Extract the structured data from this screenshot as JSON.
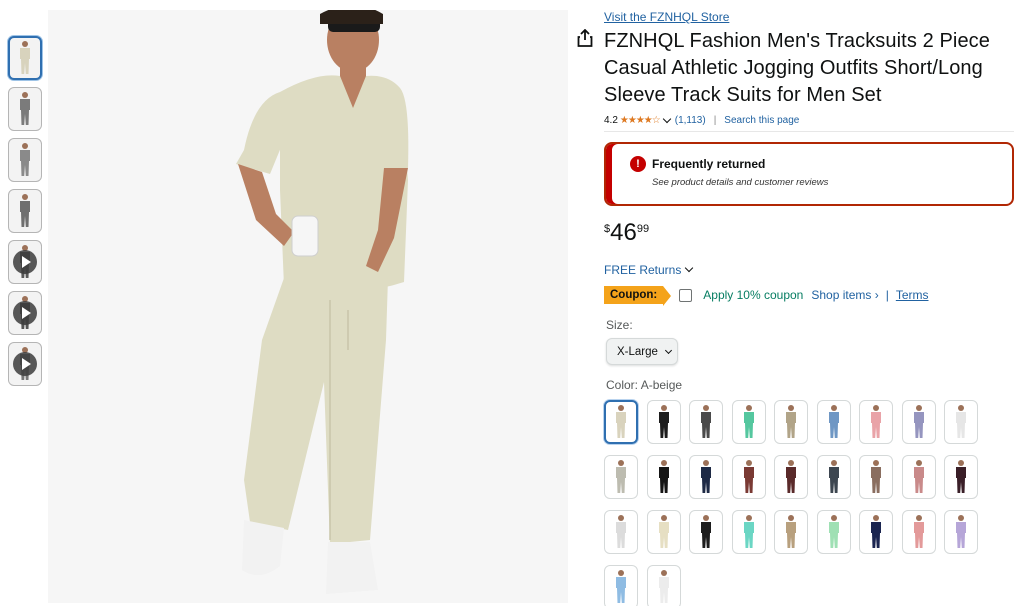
{
  "store_link": "Visit the FZNHQL Store",
  "title": "FZNHQL Fashion Men's Tracksuits 2 Piece Casual Athletic Jogging Outfits Short/Long Sleeve Track Suits for Men Set",
  "rating": {
    "value": "4.2",
    "stars": "★★★★☆",
    "count": "(1,113)",
    "separator": "|",
    "search": "Search this page"
  },
  "alert": {
    "icon": "!",
    "heading": "Frequently returned",
    "subtext": "See product details and customer reviews"
  },
  "price": {
    "currency": "$",
    "whole": "46",
    "fraction": "99"
  },
  "returns": "FREE Returns",
  "coupon": {
    "badge": "Coupon:",
    "text": "Apply 10% coupon",
    "shop": "Shop items ›",
    "separator": "|",
    "terms": "Terms"
  },
  "size": {
    "label": "Size:",
    "selected": "X-Large"
  },
  "color": {
    "label": "Color:",
    "selected": "A-beige"
  },
  "thumbnails": [
    {
      "kind": "image",
      "color": "#d8d3bd",
      "selected": true
    },
    {
      "kind": "image",
      "color": "#7b7b7b"
    },
    {
      "kind": "image",
      "color": "#8a8a8a"
    },
    {
      "kind": "image",
      "color": "#6f6f6f"
    },
    {
      "kind": "video",
      "color": "#5a5a5a"
    },
    {
      "kind": "video",
      "color": "#555555"
    },
    {
      "kind": "video",
      "color": "#777777"
    }
  ],
  "swatch_colors": [
    "#d9d3bd",
    "#1d1d1d",
    "#4a4a4a",
    "#55c79f",
    "#b1a488",
    "#6f97c4",
    "#e9a3a8",
    "#9595bf",
    "#e6e6e6",
    "#bdbcb0",
    "#151515",
    "#1e2a45",
    "#7a3a34",
    "#5a2a2a",
    "#3d4650",
    "#8a6e60",
    "#c98a8a",
    "#3a1f28",
    "#dcdcdc",
    "#e6dfc3",
    "#1d1d1d",
    "#6bd6c4",
    "#b8a07e",
    "#9fe0b4",
    "#1b2550",
    "#e39a9a",
    "#b6a6d8",
    "#8fbce3",
    "#ececec"
  ],
  "main_image": {
    "shirt_color": "#dedcc3",
    "skin_color": "#b98062",
    "shoe_color": "#f2f2f2"
  }
}
